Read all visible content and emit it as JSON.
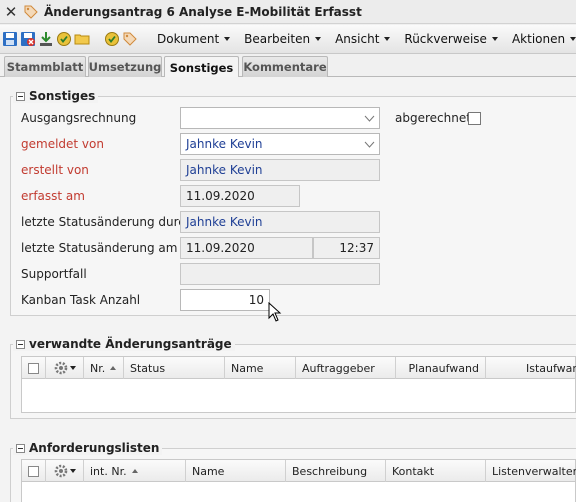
{
  "window": {
    "title": "Änderungsantrag 6 Analyse E-Mobilität Erfasst",
    "close_icon": "close-icon",
    "tag_icon": "tag-icon"
  },
  "toolbar": {
    "icons": [
      "save-icon",
      "delete-icon",
      "download-icon",
      "confirm-icon",
      "folder-icon",
      "refresh-icon",
      "tag-icon"
    ],
    "menus": [
      "Dokument",
      "Bearbeiten",
      "Ansicht",
      "Rückverweise",
      "Aktionen"
    ]
  },
  "tabs": [
    "Stammblatt",
    "Umsetzung",
    "Sonstiges",
    "Kommentare"
  ],
  "active_tab": "Sonstiges",
  "sonstiges": {
    "legend": "Sonstiges",
    "ausgangsrechnung_label": "Ausgangsrechnung",
    "ausgangsrechnung_value": "",
    "abgerechnet_label": "abgerechnet",
    "abgerechnet_checked": false,
    "gemeldet_von_label": "gemeldet von",
    "gemeldet_von_value": "Jahnke Kevin",
    "erstellt_von_label": "erstellt von",
    "erstellt_von_value": "Jahnke Kevin",
    "erfasst_am_label": "erfasst am",
    "erfasst_am_value": "11.09.2020",
    "status_durch_label": "letzte Statusänderung durch",
    "status_durch_value": "Jahnke Kevin",
    "status_am_label": "letzte Statusänderung am",
    "status_am_date": "11.09.2020",
    "status_am_time": "12:37",
    "supportfall_label": "Supportfall",
    "supportfall_value": "",
    "kanban_label": "Kanban Task Anzahl",
    "kanban_value": "10"
  },
  "verwandte": {
    "legend": "verwandte Änderungsanträge",
    "columns": [
      "Nr.",
      "Status",
      "Name",
      "Auftraggeber",
      "Planaufwand",
      "Istaufwand"
    ]
  },
  "anforderungslisten": {
    "legend": "Anforderungslisten",
    "columns": [
      "int. Nr.",
      "Name",
      "Beschreibung",
      "Kontakt",
      "Listenverwalter"
    ]
  },
  "colors": {
    "required_label": "#c23b30",
    "link_value": "#1f3f95"
  }
}
